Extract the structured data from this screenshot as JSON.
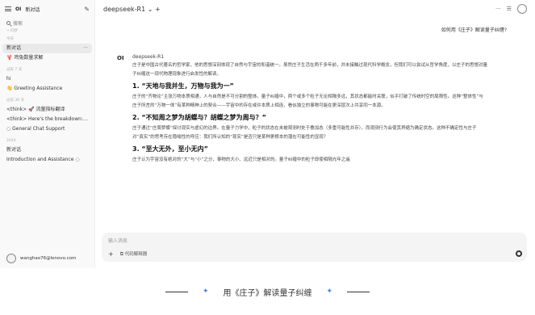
{
  "sidebar": {
    "logo": "OI",
    "new_chat": "新对话",
    "search_placeholder": "搜索",
    "groups": {
      "g0": "→ 同步",
      "g1": "今天",
      "g2": "过去 7 天",
      "g3": "过去 30 天",
      "g4": "2024"
    },
    "items": [
      "新对话",
      "🦞 鸡兔数量求解",
      "hi",
      "👋 Greeting Assistance",
      "<think> 🚀 流量指标翻译",
      "<think> Here's the breakdown: 1.",
      "◌ General Chat Support",
      "新对话",
      "Introduction and Assistance ◌"
    ],
    "item_more": "···",
    "user": "wanghao76@lenovo.com"
  },
  "header": {
    "model": "deepseek-R1 ⌄ +",
    "more": "···",
    "settings": "☰"
  },
  "question": "如何用《庄子》解读量子纠缠?",
  "answer": {
    "icon": "OI",
    "model_name": "deepseek-R1",
    "intro": "庄子是中国古代著名的哲学家，他的思想深刻体现了自然与宇宙的和谐统一。虽然庄子生活在两千多年前，并未接触过现代科学概念，但我们可以尝试从哲学角度，以庄子的思想对量子纠缠这一现代物理现象进行启发性的解读。",
    "h1": "1. “天地与我并生，万物与我为一”",
    "p1": "庄子的“齐物论”主张万物本质相通，人与自然是不可分割的整体。量子纠缠中，两个或多个粒子无论相隔多远，其状态都能时关联，似乎打破了传统时空的局限性。这种“整体性”与庄子所言的“万物一体”有某种精神上的契合——宇宙中的存在或许本质上相连，看似独立的事物可能在更深层次上共享同一本源。",
    "h2": "2. “不知周之梦为胡蝶与？胡蝶之梦为周与？”",
    "p2": "庄子通过“庄周梦蝶”探讨现实与虚幻的边界。在量子力学中，粒子的状态在未被观测时处于叠加态（多重可能性并存），而观测行为会使其坍缩为确定状态。这种不确定性与庄子对“真实”的思考存在隐喻性的呼应：我们所认知的“现实”是否只是某种更根本的潜在可能性的显现？",
    "h3": "3. “至大无外，至小无内”",
    "p3": "庄子认为宇宙没有绝对的“大”与“小”之分，事物的大小、远近只是相对的。量子纠缠中的粒子即使相隔光年之遥"
  },
  "input": {
    "placeholder": "输入消息",
    "plus": "+",
    "tool_icon": "⧉",
    "tool_label": "代码解释器"
  },
  "caption": {
    "text": "用《庄子》解读量子纠缠",
    "star": "✦"
  }
}
